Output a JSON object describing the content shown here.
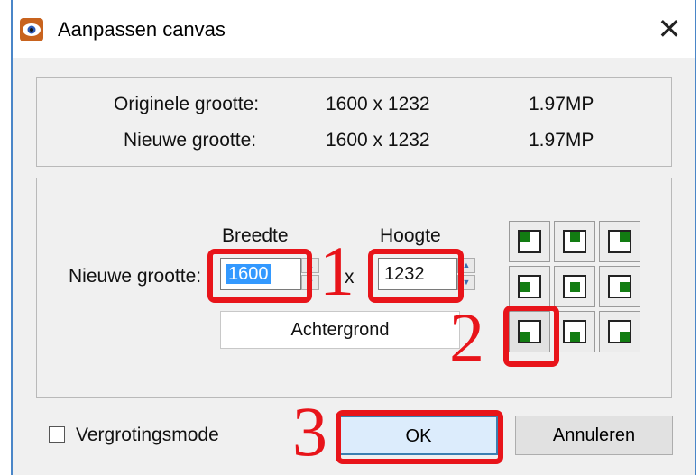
{
  "window": {
    "title": "Aanpassen canvas"
  },
  "info": {
    "original_label": "Originele grootte:",
    "original_dims": "1600 x 1232",
    "original_mp": "1.97MP",
    "new_label": "Nieuwe grootte:",
    "new_dims": "1600 x 1232",
    "new_mp": "1.97MP"
  },
  "resize": {
    "new_size_label": "Nieuwe grootte:",
    "width_label": "Breedte",
    "height_label": "Hoogte",
    "width_value": "1600",
    "height_value": "1232",
    "separator": "x",
    "background_button": "Achtergrond"
  },
  "anchor_grid": {
    "selected": "bottom-left",
    "cells": [
      "top-left",
      "top-center",
      "top-right",
      "middle-left",
      "center",
      "middle-right",
      "bottom-left",
      "bottom-center",
      "bottom-right"
    ]
  },
  "annotations": {
    "one": "1",
    "two": "2",
    "three": "3",
    "color": "#e8141a"
  },
  "footer": {
    "checkbox_label": "Vergrotingsmode",
    "checkbox_checked": false,
    "ok_label": "OK",
    "cancel_label": "Annuleren"
  }
}
